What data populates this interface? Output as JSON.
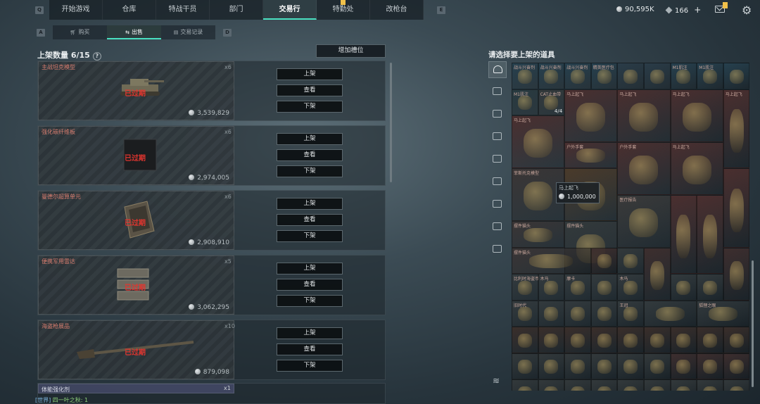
{
  "nav": {
    "left_key": "Q",
    "right_key": "E",
    "tabs": [
      "开始游戏",
      "仓库",
      "特战干员",
      "部门",
      "交易行",
      "特勤处",
      "改枪台"
    ],
    "active": 4,
    "badge_tab": 5
  },
  "currency": {
    "coins": "90,595K",
    "diamonds": "166",
    "plus": "+"
  },
  "icons": {
    "mail": "mail-icon",
    "settings": "gear-icon",
    "coin": "coin-icon",
    "diamond": "diamond-icon"
  },
  "subnav": {
    "left_key": "A",
    "right_key": "D",
    "tabs": [
      "购买",
      "出售",
      "交易记录"
    ],
    "active": 1
  },
  "listings_header": {
    "title": "上架数量 6/15",
    "help": "?",
    "add_slot": "增加槽位"
  },
  "listings": [
    {
      "name": "主战坦克模型",
      "qty": "x6",
      "status": "已过期",
      "price": "3,539,829",
      "icon": "tank-model"
    },
    {
      "name": "强化碳纤维板",
      "qty": "x6",
      "status": "已过期",
      "price": "2,974,005",
      "icon": "carbon-plate"
    },
    {
      "name": "曼德尔超算单元",
      "qty": "x6",
      "status": "已过期",
      "price": "2,908,910",
      "icon": "compute-unit"
    },
    {
      "name": "便携军用雷达",
      "qty": "x5",
      "status": "已过期",
      "price": "3,062,295",
      "icon": "military-radar"
    },
    {
      "name": "海盗枪展品",
      "qty": "x10",
      "status": "已过期",
      "price": "879,098",
      "icon": "pirate-rifle"
    },
    {
      "name": "体能强化剂",
      "qty": "x1"
    }
  ],
  "buttons": {
    "list": "上架",
    "view": "查看",
    "delist": "下架"
  },
  "chat": {
    "channel": "[世界]",
    "message": "四一叶之秋: 1"
  },
  "right_panel": {
    "title": "请选择要上架的道具",
    "tooltip_name": "马上起飞",
    "tooltip_price": "1,000,000",
    "badge_count": "4/4"
  },
  "inventory_labels": [
    "战斗兴奋剂",
    "战斗兴奋剂",
    "战斗兴奋剂",
    "精英医疗包",
    "",
    "",
    "M1肌注",
    "M1肌注",
    "",
    "M1肌注",
    "CAT止血带",
    "马上起飞",
    "马上起飞",
    "马上起飞",
    "马上起飞",
    "马上起飞",
    "户外手套",
    "户外手套",
    "马上起飞",
    "菲斯托克模型",
    "医疗报告",
    "摆件猫头",
    "摆件猫头",
    "摆件猫头",
    "比利时海盗币",
    "木马",
    "摩卡",
    "木马",
    "旧时代",
    "王冠",
    "狐狸之眼"
  ]
}
